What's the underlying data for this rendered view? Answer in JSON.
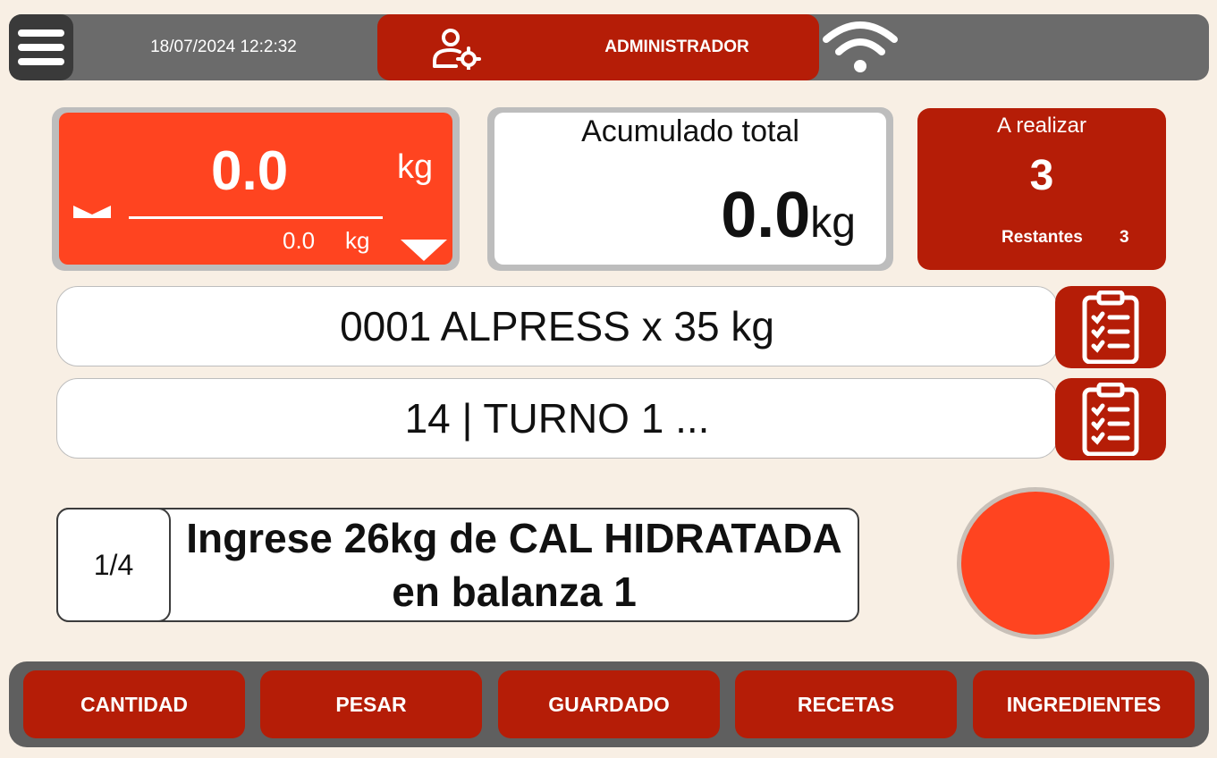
{
  "header": {
    "datetime": "18/07/2024 12:2:32",
    "user_role": "ADMINISTRADOR",
    "icons": [
      "menu-icon",
      "user-settings-icon",
      "wifi-icon"
    ]
  },
  "weight": {
    "value": "0.0",
    "unit": "kg",
    "sub_value": "0.0",
    "sub_unit": "kg"
  },
  "accumulated": {
    "title": "Acumulado total",
    "value": "0.0",
    "unit": "kg"
  },
  "pending": {
    "title": "A realizar",
    "count": "3",
    "remaining_label": "Restantes",
    "remaining_count": "3"
  },
  "recipe_row": {
    "text": "0001 ALPRESS x 35 kg"
  },
  "shift_row": {
    "text": "14 | TURNO 1 ..."
  },
  "instruction": {
    "step": "1/4",
    "line1": "Ingrese 26kg de CAL HIDRATADA",
    "line2": "en balanza 1"
  },
  "bottom_nav": {
    "cantidad": "CANTIDAD",
    "pesar": "PESAR",
    "guardado": "GUARDADO",
    "recetas": "RECETAS",
    "ingredientes": "INGREDIENTES"
  },
  "colors": {
    "accent_dark": "#b51d07",
    "accent_bright": "#ff4420",
    "background": "#f8efe4",
    "bar_gray": "#6b6b6b"
  }
}
